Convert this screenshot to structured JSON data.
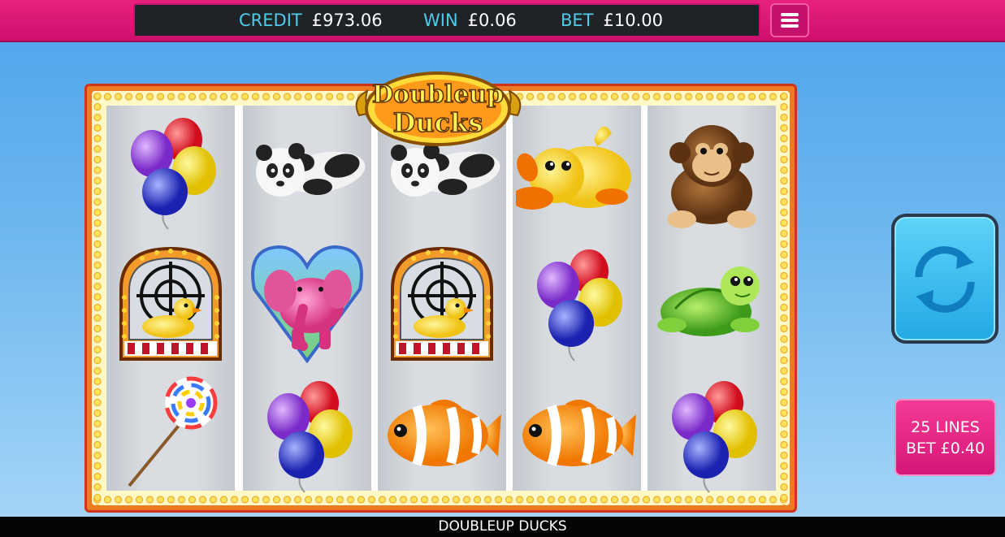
{
  "header": {
    "credit_label": "CREDIT",
    "credit_value": "£973.06",
    "win_label": "WIN",
    "win_value": "£0.06",
    "bet_label": "BET",
    "bet_value": "£10.00",
    "menu_icon": "hamburger-menu-icon"
  },
  "logo": {
    "line1": "Doubleup",
    "line2": "Ducks"
  },
  "reels": [
    [
      "balloons",
      "duck-shooting-gallery",
      "lollipop"
    ],
    [
      "panda",
      "elephant-heart",
      "balloons"
    ],
    [
      "panda",
      "duck-shooting-gallery",
      "clownfish"
    ],
    [
      "rubber-duck",
      "balloons",
      "clownfish"
    ],
    [
      "monkey",
      "turtle",
      "balloons"
    ]
  ],
  "controls": {
    "spin_icon": "spin-arrows-icon",
    "lines_text": "25 LINES",
    "line_bet_text": "BET £0.40"
  },
  "footer": {
    "game_title": "DOUBLEUP DUCKS"
  },
  "colors": {
    "header_pink": "#e8217f",
    "label_cyan": "#4ecbe7",
    "spin_blue": "#23a9e4",
    "frame_orange": "#ec7a23"
  }
}
